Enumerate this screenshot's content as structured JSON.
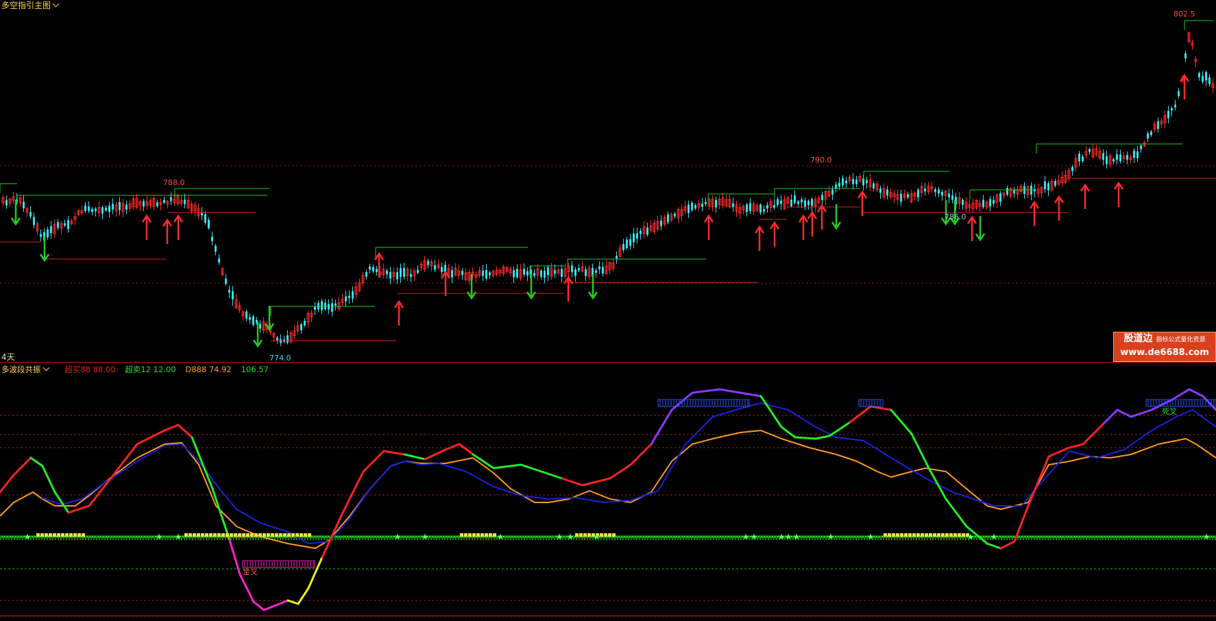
{
  "main_panel": {
    "title": "多空指引主图",
    "period_label": "4天",
    "price_labels": [
      "788.0",
      "774.0",
      "790.0",
      "786.0",
      "802.5"
    ]
  },
  "sub_panel": {
    "title": "多波段共振",
    "legend": [
      {
        "text": "超买88 88.00",
        "color": "#e02020"
      },
      {
        "text": "超卖12 12.00",
        "color": "#22e022"
      },
      {
        "text": "D888 74.92",
        "color": "#ff9a20"
      },
      {
        "text": "106.57",
        "color": "#22e022"
      }
    ],
    "tags": [
      "金叉",
      "死叉"
    ]
  },
  "watermark": {
    "line1": "股道边",
    "line1_small": "指标公式量化资源",
    "line2": "www.de6688.com"
  },
  "colors": {
    "up": "#ff2a2a",
    "down": "#36e0ef",
    "support": "#22cc22",
    "resist": "#dd2020",
    "k_line": "#ff2a2a",
    "d_line": "#ff9a20"
  }
}
